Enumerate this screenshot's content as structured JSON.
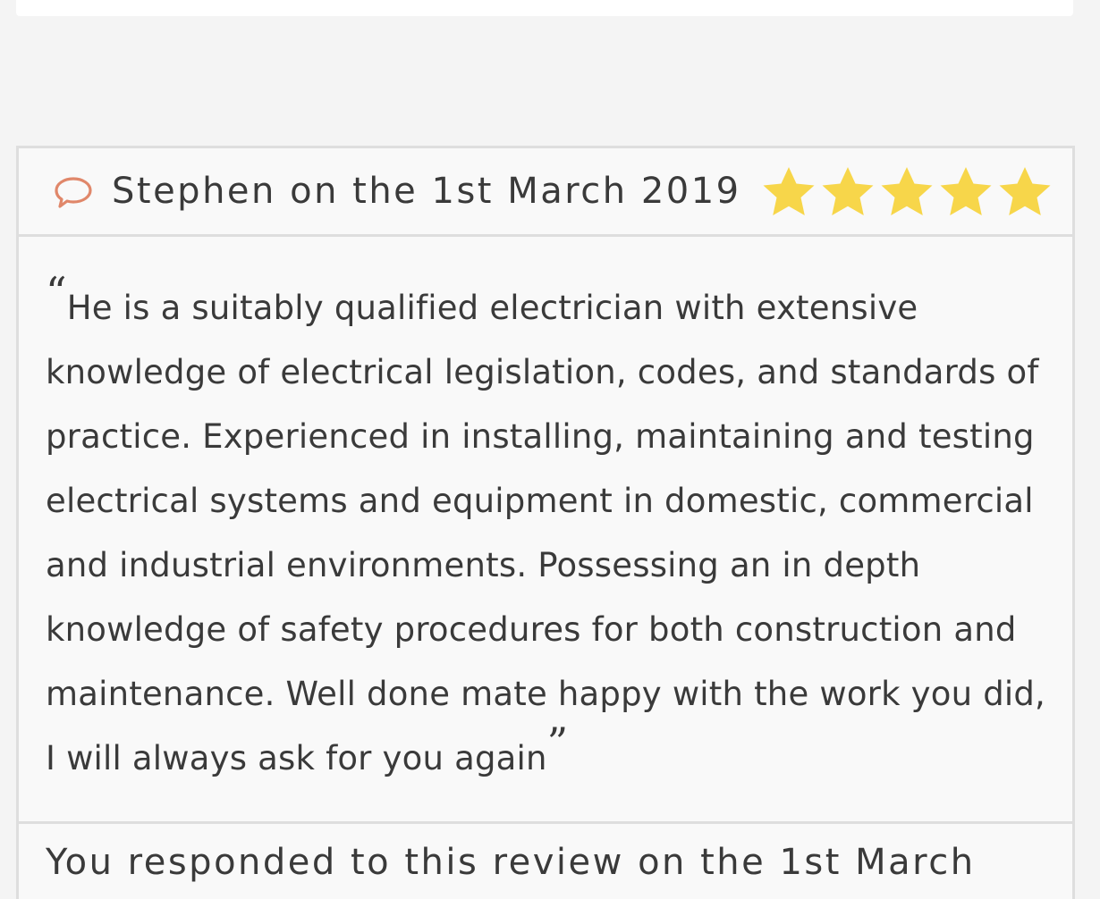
{
  "review": {
    "author_date": "Stephen on the 1st March 2019",
    "rating": 5,
    "max_rating": 5,
    "icon": "comment-icon",
    "star_color": "#f7d64a",
    "icon_color": "#e0876a",
    "open_quote": "“",
    "close_quote": "”",
    "text": "He is a suitably qualified electrician with extensive knowledge of electrical legislation, codes, and standards of practice. Experienced in installing, maintaining and testing electrical systems and equipment in domestic, commercial and industrial environments. Possessing an in depth knowledge of safety procedures for both construction and maintenance. Well done mate happy with the work you did, I will always ask for you again"
  },
  "response": {
    "text": "You responded to this review on the 1st March"
  }
}
